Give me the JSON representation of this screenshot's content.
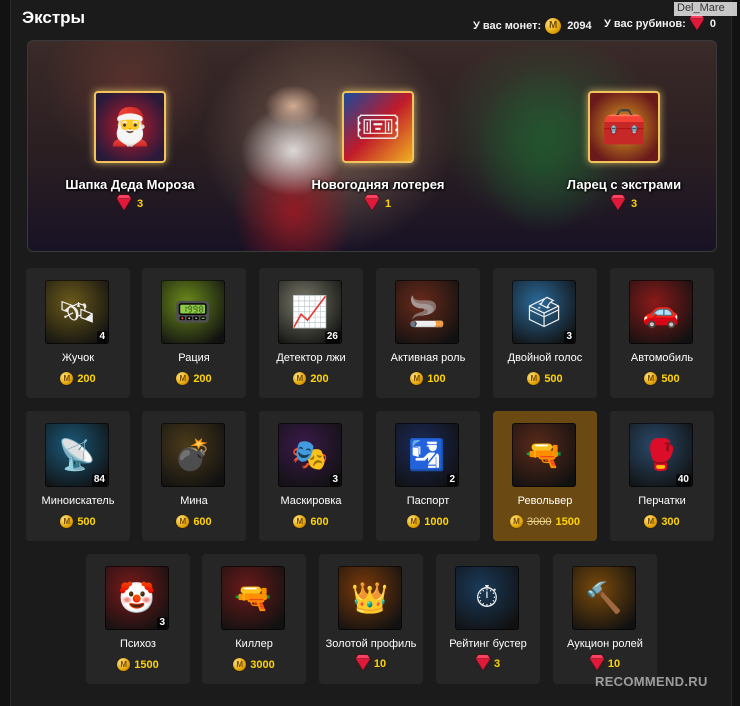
{
  "header": {
    "title": "Экстры",
    "coins_label": "У вас монет:",
    "coins_value": "2094",
    "rubies_label": "У вас рубинов:",
    "rubies_value": "0",
    "username_tag": "Del_Mare"
  },
  "banner": {
    "items": [
      {
        "name": "Шапка Деда Мороза",
        "price": "3",
        "currency": "ruby",
        "icon": "santa-hat-icon"
      },
      {
        "name": "Новогодняя лотерея",
        "price": "1",
        "currency": "ruby",
        "icon": "lottery-ticket-icon"
      },
      {
        "name": "Ларец с экстрами",
        "price": "3",
        "currency": "ruby",
        "icon": "treasure-chest-icon"
      }
    ]
  },
  "extras": [
    {
      "name": "Жучок",
      "price": "200",
      "currency": "coin",
      "count": "4",
      "icon": "bug-device-icon",
      "color": "#6b5a1a"
    },
    {
      "name": "Рация",
      "price": "200",
      "currency": "coin",
      "count": "",
      "icon": "walkie-talkie-icon",
      "color": "#6a8a1a"
    },
    {
      "name": "Детектор лжи",
      "price": "200",
      "currency": "coin",
      "count": "26",
      "icon": "lie-detector-icon",
      "color": "#7a7a6a"
    },
    {
      "name": "Активная роль",
      "price": "100",
      "currency": "coin",
      "count": "",
      "icon": "mafia-man-icon",
      "color": "#6a2a1a"
    },
    {
      "name": "Двойной голос",
      "price": "500",
      "currency": "coin",
      "count": "3",
      "icon": "ballot-icon",
      "color": "#2a6a9a"
    },
    {
      "name": "Автомобиль",
      "price": "500",
      "currency": "coin",
      "count": "",
      "icon": "car-icon",
      "color": "#8a1a1a"
    },
    {
      "name": "Миноискатель",
      "price": "500",
      "currency": "coin",
      "count": "84",
      "icon": "mine-detector-icon",
      "color": "#1a5a7a"
    },
    {
      "name": "Мина",
      "price": "600",
      "currency": "coin",
      "count": "",
      "icon": "mine-icon",
      "color": "#4a3a1a"
    },
    {
      "name": "Маскировка",
      "price": "600",
      "currency": "coin",
      "count": "3",
      "icon": "mask-icon",
      "color": "#3a1a4a"
    },
    {
      "name": "Паспорт",
      "price": "1000",
      "currency": "coin",
      "count": "2",
      "icon": "passport-icon",
      "color": "#1a2a5a"
    },
    {
      "name": "Револьвер",
      "price_old": "3000",
      "price": "1500",
      "currency": "coin",
      "count": "",
      "icon": "revolver-icon",
      "color": "#5a2a1a",
      "selected": true
    },
    {
      "name": "Перчатки",
      "price": "300",
      "currency": "coin",
      "count": "40",
      "icon": "boxing-gloves-icon",
      "color": "#2a4a6a"
    },
    {
      "name": "Психоз",
      "price": "1500",
      "currency": "coin",
      "count": "3",
      "icon": "jigsaw-mask-icon",
      "color": "#7a1a1a"
    },
    {
      "name": "Киллер",
      "price": "3000",
      "currency": "coin",
      "count": "",
      "icon": "pistol-icon",
      "color": "#6a1a1a"
    },
    {
      "name": "Золотой профиль",
      "price": "10",
      "currency": "ruby",
      "count": "",
      "icon": "crown-icon",
      "color": "#7a3a0a"
    },
    {
      "name": "Рейтинг бустер",
      "price": "3",
      "currency": "ruby",
      "count": "",
      "icon": "speedometer-icon",
      "color": "#1a3a5a"
    },
    {
      "name": "Аукцион ролей",
      "price": "10",
      "currency": "ruby",
      "count": "",
      "icon": "gavel-icon",
      "color": "#7a4a0a"
    }
  ],
  "watermark": "RECOMMEND.RU",
  "colors": {
    "accent": "#ffd400",
    "selected": "#6a4a12",
    "ruby": "#e0183a"
  }
}
